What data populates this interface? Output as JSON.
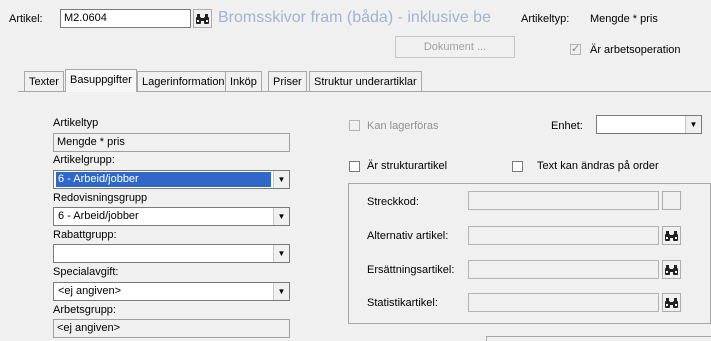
{
  "header": {
    "artikel_label": "Artikel:",
    "artikel_value": "M2.0604",
    "description": "Bromsskivor fram (båda) - inklusive be",
    "artikeltyp_label": "Artikeltyp:",
    "artikeltyp_value": "Mengde * pris",
    "dokument_button": "Dokument ...",
    "arbetsoperation_label": "Är arbetsoperation",
    "arbetsoperation_checked": true
  },
  "tabs": [
    {
      "label": "Texter",
      "active": false
    },
    {
      "label": "Basuppgifter",
      "active": true
    },
    {
      "label": "Lagerinformation",
      "active": false
    },
    {
      "label": "Inköp",
      "active": false
    },
    {
      "label": "Priser",
      "active": false
    },
    {
      "label": "Struktur underartiklar",
      "active": false
    }
  ],
  "left": {
    "artikeltyp_label": "Artikeltyp",
    "artikeltyp_value": "Mengde * pris",
    "artikelgrupp_label": "Artikelgrupp:",
    "artikelgrupp_value": "6 - Arbeid/jobber",
    "redovisningsgrupp_label": "Redovisningsgrupp",
    "redovisningsgrupp_value": "6 - Arbeid/jobber",
    "rabattgrupp_label": "Rabattgrupp:",
    "rabattgrupp_value": "",
    "specialavgift_label": "Specialavgift:",
    "specialavgift_value": "<ej angiven>",
    "arbetsgrupp_label": "Arbetsgrupp:",
    "arbetsgrupp_value": "<ej angiven>"
  },
  "right": {
    "kan_lagerforas_label": "Kan lagerföras",
    "enhet_label": "Enhet:",
    "enhet_value": "",
    "ar_strukturartikel_label": "Är strukturartikel",
    "text_kan_andras_label": "Text kan ändras på order",
    "streckkod_label": "Streckkod:",
    "alternativ_artikel_label": "Alternativ artikel:",
    "ersattningsartikel_label": "Ersättningsartikel:",
    "statistikartikel_label": "Statistikartikel:"
  },
  "colors": {
    "window_bg": "#f0f0f0",
    "selection": "#3168c8",
    "description_text": "#a0b4cc"
  },
  "icons": {
    "find": "binoculars-icon",
    "dropdown": "chevron-down-icon",
    "check": "checkmark-icon"
  }
}
